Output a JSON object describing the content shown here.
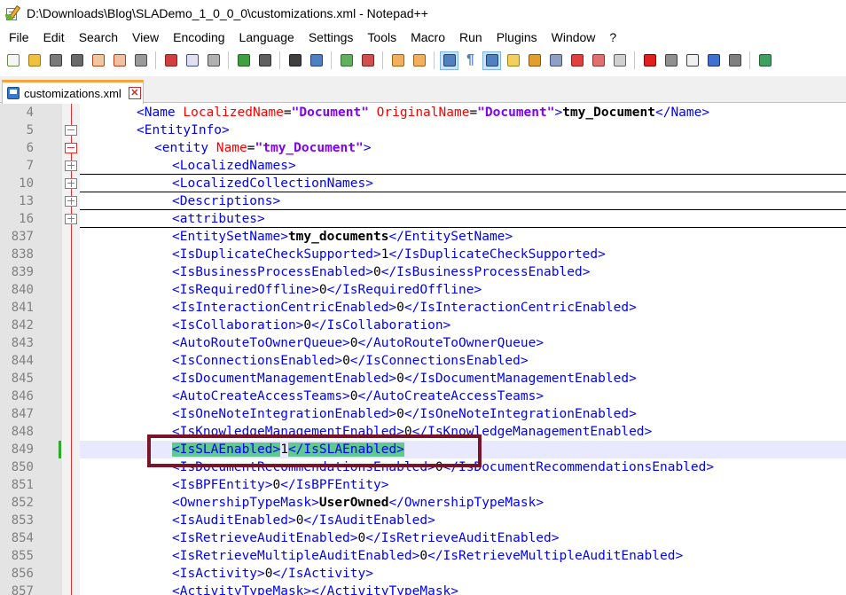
{
  "window": {
    "title": "D:\\Downloads\\Blog\\SLADemo_1_0_0_0\\customizations.xml - Notepad++"
  },
  "menu": {
    "items": [
      {
        "label": "File",
        "key": "file"
      },
      {
        "label": "Edit",
        "key": "edit"
      },
      {
        "label": "Search",
        "key": "search"
      },
      {
        "label": "View",
        "key": "view"
      },
      {
        "label": "Encoding",
        "key": "encoding"
      },
      {
        "label": "Language",
        "key": "language"
      },
      {
        "label": "Settings",
        "key": "settings"
      },
      {
        "label": "Tools",
        "key": "tools"
      },
      {
        "label": "Macro",
        "key": "macro"
      },
      {
        "label": "Run",
        "key": "run"
      },
      {
        "label": "Plugins",
        "key": "plugins"
      },
      {
        "label": "Window",
        "key": "window"
      },
      {
        "label": "?",
        "key": "help"
      }
    ]
  },
  "toolbar": {
    "buttons": [
      {
        "icon": "new-file-icon",
        "color": "#f5f5f5",
        "border": "#6a8a4a"
      },
      {
        "icon": "open-file-icon",
        "color": "#f0c040",
        "border": "#a07810"
      },
      {
        "icon": "save-icon",
        "color": "#7a7a7a",
        "border": "#3a3a3a"
      },
      {
        "icon": "save-all-icon",
        "color": "#6a6a6a",
        "border": "#3a3a3a"
      },
      {
        "icon": "close-icon",
        "color": "#f0c8a0",
        "border": "#b04020"
      },
      {
        "icon": "close-all-icon",
        "color": "#f0c0a0",
        "border": "#b04020"
      },
      {
        "icon": "print-icon",
        "color": "#9a9a9a",
        "border": "#4a4a4a"
      },
      {
        "sep": true
      },
      {
        "icon": "cut-icon",
        "color": "#d04040",
        "border": "#902020"
      },
      {
        "icon": "copy-icon",
        "color": "#e0e0f0",
        "border": "#405080"
      },
      {
        "icon": "paste-icon",
        "color": "#b0b0b0",
        "border": "#505050"
      },
      {
        "sep": true
      },
      {
        "icon": "undo-icon",
        "color": "#40a040",
        "border": "#206020"
      },
      {
        "icon": "redo-icon",
        "color": "#606060",
        "border": "#303030"
      },
      {
        "sep": true
      },
      {
        "icon": "find-icon",
        "color": "#404040",
        "border": "#202020"
      },
      {
        "icon": "replace-icon",
        "color": "#5080c0",
        "border": "#204080"
      },
      {
        "sep": true
      },
      {
        "icon": "zoom-in-icon",
        "color": "#60b060",
        "border": "#307030"
      },
      {
        "icon": "zoom-out-icon",
        "color": "#d05050",
        "border": "#802020"
      },
      {
        "sep": true
      },
      {
        "icon": "sync-vertical-icon",
        "color": "#f0b060",
        "border": "#a06010"
      },
      {
        "icon": "sync-horizontal-icon",
        "color": "#f0b060",
        "border": "#a06010"
      },
      {
        "sep": true
      },
      {
        "icon": "word-wrap-icon",
        "color": "#5080c0",
        "border": "#204080",
        "active": true
      },
      {
        "icon": "show-all-chars-icon",
        "color": "#5080c0",
        "border": "#204080",
        "glyph": "¶"
      },
      {
        "icon": "indent-guide-icon",
        "color": "#5080c0",
        "border": "#204080",
        "active": true
      },
      {
        "icon": "user-defined-language-icon",
        "color": "#f0d060",
        "border": "#a08010"
      },
      {
        "icon": "map-icon",
        "color": "#e0a030",
        "border": "#905010"
      },
      {
        "icon": "document-list-icon",
        "color": "#90a0c0",
        "border": "#405080"
      },
      {
        "icon": "function-list-icon",
        "color": "#e04040",
        "border": "#902020"
      },
      {
        "icon": "folder-as-workspace-icon",
        "color": "#e07070",
        "border": "#903030"
      },
      {
        "icon": "monitoring-icon",
        "color": "#d0d0d0",
        "border": "#606060"
      },
      {
        "sep": true
      },
      {
        "icon": "record-macro-icon",
        "color": "#e02020",
        "border": "#800000"
      },
      {
        "icon": "stop-macro-icon",
        "color": "#909090",
        "border": "#404040"
      },
      {
        "icon": "play-macro-icon",
        "color": "#f0f0f0",
        "border": "#404040"
      },
      {
        "icon": "run-macro-multiple-icon",
        "color": "#4070d0",
        "border": "#203080"
      },
      {
        "icon": "save-macro-icon",
        "color": "#808080",
        "border": "#404040"
      },
      {
        "sep": true
      },
      {
        "icon": "plugin-icon",
        "color": "#40a060",
        "border": "#206030"
      }
    ]
  },
  "tabs": [
    {
      "label": "customizations.xml",
      "active": true
    }
  ],
  "editor": {
    "lines": [
      {
        "n": "4",
        "indent": 3,
        "fold": "vline",
        "toks": [
          [
            "b",
            "<Name "
          ],
          [
            "r",
            "LocalizedName"
          ],
          [
            "k",
            "="
          ],
          [
            "v",
            "\"Document\""
          ],
          [
            "k",
            " "
          ],
          [
            "r",
            "OriginalName"
          ],
          [
            "k",
            "="
          ],
          [
            "v",
            "\"Document\""
          ],
          [
            "b",
            ">"
          ],
          [
            "t",
            "tmy_Document"
          ],
          [
            "b",
            "</Name>"
          ]
        ]
      },
      {
        "n": "5",
        "indent": 3,
        "fold": "minus",
        "toks": [
          [
            "b",
            "<EntityInfo>"
          ]
        ]
      },
      {
        "n": "6",
        "indent": 4,
        "fold": "minus-red",
        "toks": [
          [
            "b",
            "<entity "
          ],
          [
            "r",
            "Name"
          ],
          [
            "k",
            "="
          ],
          [
            "v",
            "\"tmy_Document\""
          ],
          [
            "b",
            ">"
          ]
        ]
      },
      {
        "n": "7",
        "indent": 5,
        "fold": "plus",
        "toks": [
          [
            "b",
            "<LocalizedNames>"
          ]
        ]
      },
      {
        "n": "10",
        "indent": 5,
        "fold": "plus",
        "folded": true,
        "toks": [
          [
            "b",
            "<LocalizedCollectionNames>"
          ]
        ]
      },
      {
        "n": "13",
        "indent": 5,
        "fold": "plus",
        "folded": true,
        "toks": [
          [
            "b",
            "<Descriptions>"
          ]
        ]
      },
      {
        "n": "16",
        "indent": 5,
        "fold": "plus",
        "folded": true,
        "toks": [
          [
            "b",
            "<attributes>"
          ]
        ]
      },
      {
        "n": "837",
        "indent": 5,
        "fold": "vline",
        "toks": [
          [
            "b",
            "<EntitySetName>"
          ],
          [
            "t",
            "tmy_documents"
          ],
          [
            "b",
            "</EntitySetName>"
          ]
        ]
      },
      {
        "n": "838",
        "indent": 5,
        "fold": "vline",
        "toks": [
          [
            "b",
            "<IsDuplicateCheckSupported>"
          ],
          [
            "k",
            "1"
          ],
          [
            "b",
            "</IsDuplicateCheckSupported>"
          ]
        ]
      },
      {
        "n": "839",
        "indent": 5,
        "fold": "vline",
        "toks": [
          [
            "b",
            "<IsBusinessProcessEnabled>"
          ],
          [
            "k",
            "0"
          ],
          [
            "b",
            "</IsBusinessProcessEnabled>"
          ]
        ]
      },
      {
        "n": "840",
        "indent": 5,
        "fold": "vline",
        "toks": [
          [
            "b",
            "<IsRequiredOffline>"
          ],
          [
            "k",
            "0"
          ],
          [
            "b",
            "</IsRequiredOffline>"
          ]
        ]
      },
      {
        "n": "841",
        "indent": 5,
        "fold": "vline",
        "toks": [
          [
            "b",
            "<IsInteractionCentricEnabled>"
          ],
          [
            "k",
            "0"
          ],
          [
            "b",
            "</IsInteractionCentricEnabled>"
          ]
        ]
      },
      {
        "n": "842",
        "indent": 5,
        "fold": "vline",
        "toks": [
          [
            "b",
            "<IsCollaboration>"
          ],
          [
            "k",
            "0"
          ],
          [
            "b",
            "</IsCollaboration>"
          ]
        ]
      },
      {
        "n": "843",
        "indent": 5,
        "fold": "vline",
        "toks": [
          [
            "b",
            "<AutoRouteToOwnerQueue>"
          ],
          [
            "k",
            "0"
          ],
          [
            "b",
            "</AutoRouteToOwnerQueue>"
          ]
        ]
      },
      {
        "n": "844",
        "indent": 5,
        "fold": "vline",
        "toks": [
          [
            "b",
            "<IsConnectionsEnabled>"
          ],
          [
            "k",
            "0"
          ],
          [
            "b",
            "</IsConnectionsEnabled>"
          ]
        ]
      },
      {
        "n": "845",
        "indent": 5,
        "fold": "vline",
        "toks": [
          [
            "b",
            "<IsDocumentManagementEnabled>"
          ],
          [
            "k",
            "0"
          ],
          [
            "b",
            "</IsDocumentManagementEnabled>"
          ]
        ]
      },
      {
        "n": "846",
        "indent": 5,
        "fold": "vline",
        "toks": [
          [
            "b",
            "<AutoCreateAccessTeams>"
          ],
          [
            "k",
            "0"
          ],
          [
            "b",
            "</AutoCreateAccessTeams>"
          ]
        ]
      },
      {
        "n": "847",
        "indent": 5,
        "fold": "vline",
        "toks": [
          [
            "b",
            "<IsOneNoteIntegrationEnabled>"
          ],
          [
            "k",
            "0"
          ],
          [
            "b",
            "</IsOneNoteIntegrationEnabled>"
          ]
        ]
      },
      {
        "n": "848",
        "indent": 5,
        "fold": "vline",
        "toks": [
          [
            "b",
            "<IsKnowledgeManagementEnabled>"
          ],
          [
            "k",
            "0"
          ],
          [
            "b",
            "</IsKnowledgeManagementEnabled>"
          ]
        ]
      },
      {
        "n": "849",
        "indent": 5,
        "fold": "vline",
        "current": true,
        "toks": [
          [
            "m",
            "<IsSLAEnabled>"
          ],
          [
            "k",
            "1"
          ],
          [
            "m",
            "</IsSLAEnabled>"
          ]
        ]
      },
      {
        "n": "850",
        "indent": 5,
        "fold": "vline",
        "toks": [
          [
            "b",
            "<IsDocumentRecommendationsEnabled>"
          ],
          [
            "k",
            "0"
          ],
          [
            "b",
            "</IsDocumentRecommendationsEnabled>"
          ]
        ]
      },
      {
        "n": "851",
        "indent": 5,
        "fold": "vline",
        "toks": [
          [
            "b",
            "<IsBPFEntity>"
          ],
          [
            "k",
            "0"
          ],
          [
            "b",
            "</IsBPFEntity>"
          ]
        ]
      },
      {
        "n": "852",
        "indent": 5,
        "fold": "vline",
        "toks": [
          [
            "b",
            "<OwnershipTypeMask>"
          ],
          [
            "t",
            "UserOwned"
          ],
          [
            "b",
            "</OwnershipTypeMask>"
          ]
        ]
      },
      {
        "n": "853",
        "indent": 5,
        "fold": "vline",
        "toks": [
          [
            "b",
            "<IsAuditEnabled>"
          ],
          [
            "k",
            "0"
          ],
          [
            "b",
            "</IsAuditEnabled>"
          ]
        ]
      },
      {
        "n": "854",
        "indent": 5,
        "fold": "vline",
        "toks": [
          [
            "b",
            "<IsRetrieveAuditEnabled>"
          ],
          [
            "k",
            "0"
          ],
          [
            "b",
            "</IsRetrieveAuditEnabled>"
          ]
        ]
      },
      {
        "n": "855",
        "indent": 5,
        "fold": "vline",
        "toks": [
          [
            "b",
            "<IsRetrieveMultipleAuditEnabled>"
          ],
          [
            "k",
            "0"
          ],
          [
            "b",
            "</IsRetrieveMultipleAuditEnabled>"
          ]
        ]
      },
      {
        "n": "856",
        "indent": 5,
        "fold": "vline",
        "toks": [
          [
            "b",
            "<IsActivity>"
          ],
          [
            "k",
            "0"
          ],
          [
            "b",
            "</IsActivity>"
          ]
        ]
      },
      {
        "n": "857",
        "indent": 5,
        "fold": "vline",
        "toks": [
          [
            "b",
            "<ActivityTypeMask>"
          ],
          [
            "b",
            "</ActivityTypeMask>"
          ]
        ]
      }
    ]
  },
  "colors": {
    "tag": "#0000ff",
    "attribute": "#ff0000",
    "attribute_value": "#8000ff",
    "tag_match_highlight": "#60c890",
    "current_line": "#e8e8ff",
    "annotation_box": "#7a1428",
    "tab_accent": "#f9a23a"
  }
}
